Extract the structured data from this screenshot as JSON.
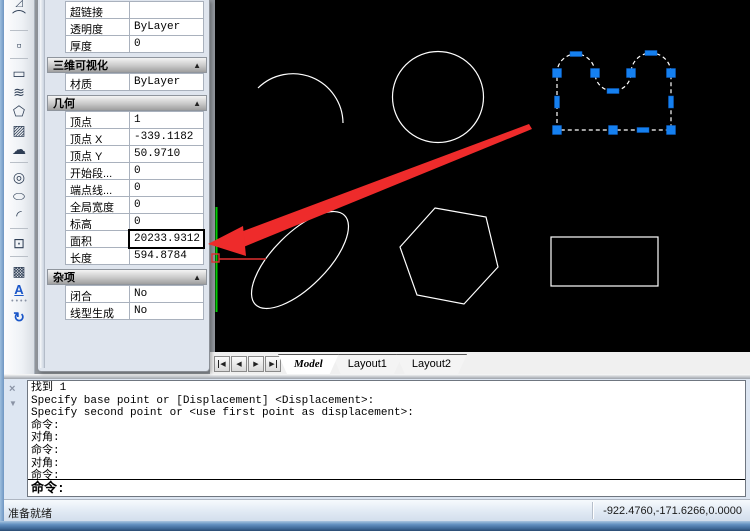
{
  "palette": {
    "sections": [
      {
        "title": null,
        "rows": [
          {
            "label": "超链接",
            "value": ""
          },
          {
            "label": "透明度",
            "value": "ByLayer"
          },
          {
            "label": "厚度",
            "value": "0"
          }
        ]
      },
      {
        "title": "三维可视化",
        "collapse_arrow": "▲",
        "rows": [
          {
            "label": "材质",
            "value": "ByLayer"
          }
        ]
      },
      {
        "title": "几何",
        "collapse_arrow": "▲",
        "rows": [
          {
            "label": "顶点",
            "value": "1"
          },
          {
            "label": "顶点 X",
            "value": "-339.1182"
          },
          {
            "label": "顶点 Y",
            "value": "50.9710"
          },
          {
            "label": "开始段...",
            "value": "0"
          },
          {
            "label": "端点线...",
            "value": "0"
          },
          {
            "label": "全局宽度",
            "value": "0"
          },
          {
            "label": "标高",
            "value": "0"
          },
          {
            "label": "面积",
            "value": "20233.9312",
            "selected": true
          },
          {
            "label": "长度",
            "value": "594.8784"
          }
        ]
      },
      {
        "title": "杂项",
        "collapse_arrow": "▲",
        "rows": [
          {
            "label": "闭合",
            "value": "No"
          },
          {
            "label": "线型生成",
            "value": "No"
          }
        ]
      }
    ]
  },
  "toolbar": {
    "items": [
      {
        "type": "icon",
        "name": "clipped-top-icon",
        "glyph": "◿",
        "partial": true
      },
      {
        "type": "icon",
        "name": "spline-edit-icon",
        "glyph": "⌒"
      },
      {
        "type": "divider"
      },
      {
        "type": "icon",
        "name": "point-icon",
        "glyph": "▫"
      },
      {
        "type": "divider"
      },
      {
        "type": "icon",
        "name": "rectangle-tool-icon",
        "glyph": "▭"
      },
      {
        "type": "icon",
        "name": "spline-icon",
        "glyph": "≋"
      },
      {
        "type": "icon",
        "name": "polygon-tool-icon",
        "glyph": "⬠"
      },
      {
        "type": "icon",
        "name": "boundary-hatch-icon",
        "glyph": "▨"
      },
      {
        "type": "icon",
        "name": "revision-cloud-icon",
        "glyph": "☁"
      },
      {
        "type": "divider"
      },
      {
        "type": "icon",
        "name": "donut-icon",
        "glyph": "◎"
      },
      {
        "type": "icon",
        "name": "ellipse-tool-icon",
        "glyph": "⬭"
      },
      {
        "type": "icon",
        "name": "fillet-arc-icon",
        "glyph": "◜"
      },
      {
        "type": "divider"
      },
      {
        "type": "icon",
        "name": "insert-block-icon",
        "glyph": "⊡"
      },
      {
        "type": "divider"
      },
      {
        "type": "icon",
        "name": "hatch-icon",
        "glyph": "▩"
      },
      {
        "type": "icon",
        "name": "text-tool-icon",
        "glyph": "A",
        "cls": "blue textA"
      },
      {
        "type": "dots"
      },
      {
        "type": "icon",
        "name": "regen-icon",
        "glyph": "↻",
        "cls": "blue"
      }
    ]
  },
  "tabs": {
    "nav": [
      {
        "name": "first-tab-button",
        "glyph": "◀",
        "pos": "first"
      },
      {
        "name": "prev-tab-button",
        "glyph": "◀",
        "pos": ""
      },
      {
        "name": "next-tab-button",
        "glyph": "▶",
        "pos": ""
      },
      {
        "name": "last-tab-button",
        "glyph": "▶",
        "pos": "last"
      }
    ],
    "items": [
      {
        "label": "Model",
        "active": true
      },
      {
        "label": "Layout1",
        "active": false
      },
      {
        "label": "Layout2",
        "active": false
      }
    ]
  },
  "command": {
    "close_glyph": "×",
    "expand_glyph": "▼",
    "history": [
      "找到 1",
      "Specify base point or [Displacement] <Displacement>:",
      "Specify second point or <use first point as displacement>:",
      "命令:",
      "对角:",
      "命令:",
      "对角:",
      "命令:"
    ],
    "prompt": "命令:"
  },
  "statusbar": {
    "ready_text": "准备就绪",
    "coordinates": "-922.4760,-171.6266,0.0000"
  },
  "canvas": {
    "entities": [
      "arc",
      "circle",
      "selected-polyline-m-shape",
      "ellipse",
      "hexagon",
      "rectangle",
      "green-line"
    ],
    "colors": {
      "background": "#000000",
      "entity_stroke": "#ffffff",
      "grip_fill": "#1580f0",
      "green_line": "#00cc00",
      "annotation_red": "#ee2b2b"
    }
  }
}
